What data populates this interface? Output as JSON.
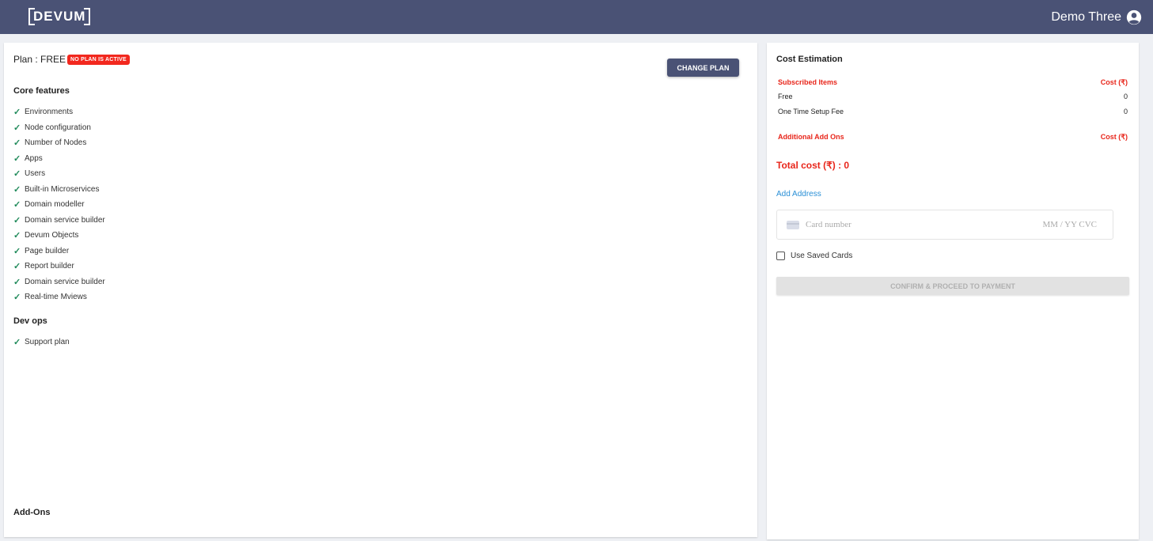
{
  "header": {
    "logo": "DEVUM",
    "user_name": "Demo Three",
    "user_icon": "account-circle-icon"
  },
  "plan": {
    "label": "Plan : FREE",
    "badge": "NO PLAN IS ACTIVE",
    "change_button": "CHANGE PLAN"
  },
  "core_features": {
    "title": "Core features",
    "items": [
      "Environments",
      "Node configuration",
      "Number of Nodes",
      "Apps",
      "Users",
      "Built-in Microservices",
      "Domain modeller",
      "Domain service builder",
      "Devum Objects",
      "Page builder",
      "Report builder",
      "Domain service builder",
      "Real-time Mviews"
    ]
  },
  "dev_ops": {
    "title": "Dev ops",
    "items": [
      "Support plan"
    ]
  },
  "add_ons": {
    "title": "Add-Ons"
  },
  "check_glyph": "✓",
  "cost": {
    "title": "Cost Estimation",
    "subscribed_header": "Subscribed Items",
    "cost_header": "Cost (₹)",
    "items": [
      {
        "name": "Free",
        "value": "0"
      },
      {
        "name": "One Time Setup Fee",
        "value": "0"
      }
    ],
    "addons_header": "Additional Add Ons",
    "addons_cost_header": "Cost (₹)",
    "total": "Total cost (₹) : 0",
    "add_address": "Add Address",
    "card_placeholder": "Card number",
    "card_expiry_placeholder": "MM / YY  CVC",
    "use_saved_cards": "Use Saved Cards",
    "confirm_button": "CONFIRM & PROCEED TO PAYMENT"
  },
  "colors": {
    "header_bg": "#4a5275",
    "accent_red": "#e8261b",
    "link_blue": "#2a8fd6",
    "check_green": "#1f8a5a"
  }
}
